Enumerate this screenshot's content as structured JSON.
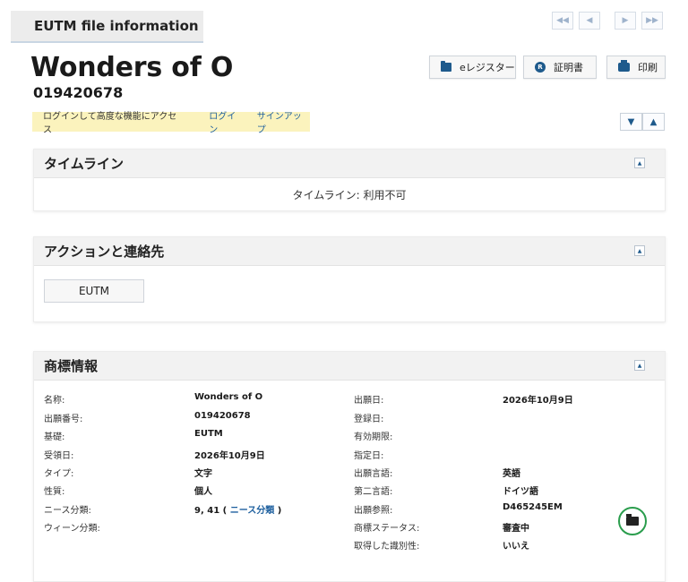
{
  "tab": {
    "label": "EUTM file information"
  },
  "pager": {
    "first": "◀◀",
    "prev": "◀",
    "next": "▶",
    "last": "▶▶"
  },
  "header": {
    "title": "Wonders of O",
    "number": "019420678"
  },
  "actions": {
    "eregister": "eレジスター",
    "certificate": "証明書",
    "print": "印刷",
    "cert_icon_letter": "R"
  },
  "notice": {
    "text": "ログインして高度な機能にアクセス",
    "login": "ログイン",
    "signup": "サインアップ"
  },
  "expand": {
    "expand_all": "▼",
    "collapse_all": "▲"
  },
  "timeline": {
    "title": "タイムライン",
    "message": "タイムライン: 利用不可"
  },
  "contacts": {
    "title": "アクションと連絡先",
    "button": "EUTM"
  },
  "trademark": {
    "title": "商標情報",
    "left": [
      {
        "label": "名称:",
        "value": "Wonders of O"
      },
      {
        "label": "出願番号:",
        "value": "019420678"
      },
      {
        "label": "基礎:",
        "value": "EUTM"
      },
      {
        "label": "受領日:",
        "value": "2026年10月9日"
      },
      {
        "label": "タイプ:",
        "value": "文字"
      },
      {
        "label": "性質:",
        "value": "個人"
      },
      {
        "label": "ニース分類:",
        "value": "9, 41 (",
        "link": "ニース分類",
        "suffix": ")"
      },
      {
        "label": "ウィーン分類:",
        "value": ""
      }
    ],
    "right": [
      {
        "label": "出願日:",
        "value": "2026年10月9日"
      },
      {
        "label": "登録日:",
        "value": ""
      },
      {
        "label": "有効期限:",
        "value": ""
      },
      {
        "label": "指定日:",
        "value": ""
      },
      {
        "label": "出願言語:",
        "value": "英語"
      },
      {
        "label": "第二言語:",
        "value": "ドイツ語"
      },
      {
        "label": "出願参照:",
        "value": "D465245EM"
      },
      {
        "label": "商標ステータス:",
        "value": "審査中"
      },
      {
        "label": "取得した識別性:",
        "value": "いいえ"
      }
    ]
  },
  "colors": {
    "accent": "#1e5a8c",
    "link": "#1d5f9e",
    "notice_bg": "#fbf3bd",
    "status_ring": "#2a9d4d"
  }
}
